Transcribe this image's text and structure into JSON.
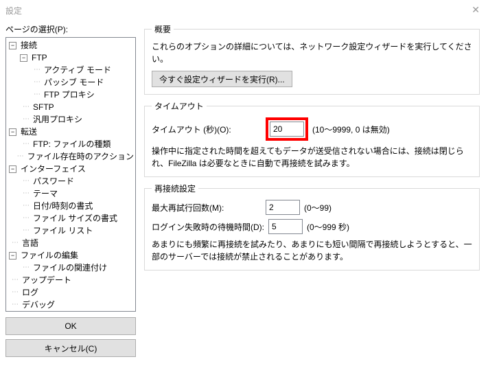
{
  "window": {
    "title": "設定"
  },
  "left": {
    "label": "ページの選択(P):",
    "ok": "OK",
    "cancel": "キャンセル(C)"
  },
  "tree": {
    "connection": "接続",
    "ftp": "FTP",
    "active": "アクティブ モード",
    "passive": "パッシブ モード",
    "ftpproxy": "FTP プロキシ",
    "sftp": "SFTP",
    "genericproxy": "汎用プロキシ",
    "transfer": "転送",
    "ftpfiletypes": "FTP: ファイルの種類",
    "fileexists": "ファイル存在時のアクション",
    "interface": "インターフェイス",
    "password": "パスワード",
    "theme": "テーマ",
    "dateformat": "日付/時刻の書式",
    "filesize": "ファイル サイズの書式",
    "filelist": "ファイル リスト",
    "language": "言語",
    "fileedit": "ファイルの編集",
    "fileassoc": "ファイルの関連付け",
    "update": "アップデート",
    "log": "ログ",
    "debug": "デバッグ"
  },
  "overview": {
    "legend": "概要",
    "desc": "これらのオプションの詳細については、ネットワーク設定ウィザードを実行してください。",
    "wizard_btn": "今すぐ設定ウィザードを実行(R)..."
  },
  "timeout": {
    "legend": "タイムアウト",
    "label": "タイムアウト (秒)(O):",
    "value": "20",
    "hint": "(10〜9999, 0 は無効)",
    "desc": "操作中に指定された時間を超えてもデータが送受信されない場合には、接続は閉じられ、FileZilla は必要なときに自動で再接続を試みます。"
  },
  "reconnect": {
    "legend": "再接続設定",
    "max_label": "最大再試行回数(M):",
    "max_value": "2",
    "max_hint": "(0〜99)",
    "delay_label": "ログイン失敗時の待機時間(D):",
    "delay_value": "5",
    "delay_hint": "(0〜999 秒)",
    "desc": "あまりにも頻繁に再接続を試みたり、あまりにも短い間隔で再接続しようとすると、一部のサーバーでは接続が禁止されることがあります。"
  }
}
